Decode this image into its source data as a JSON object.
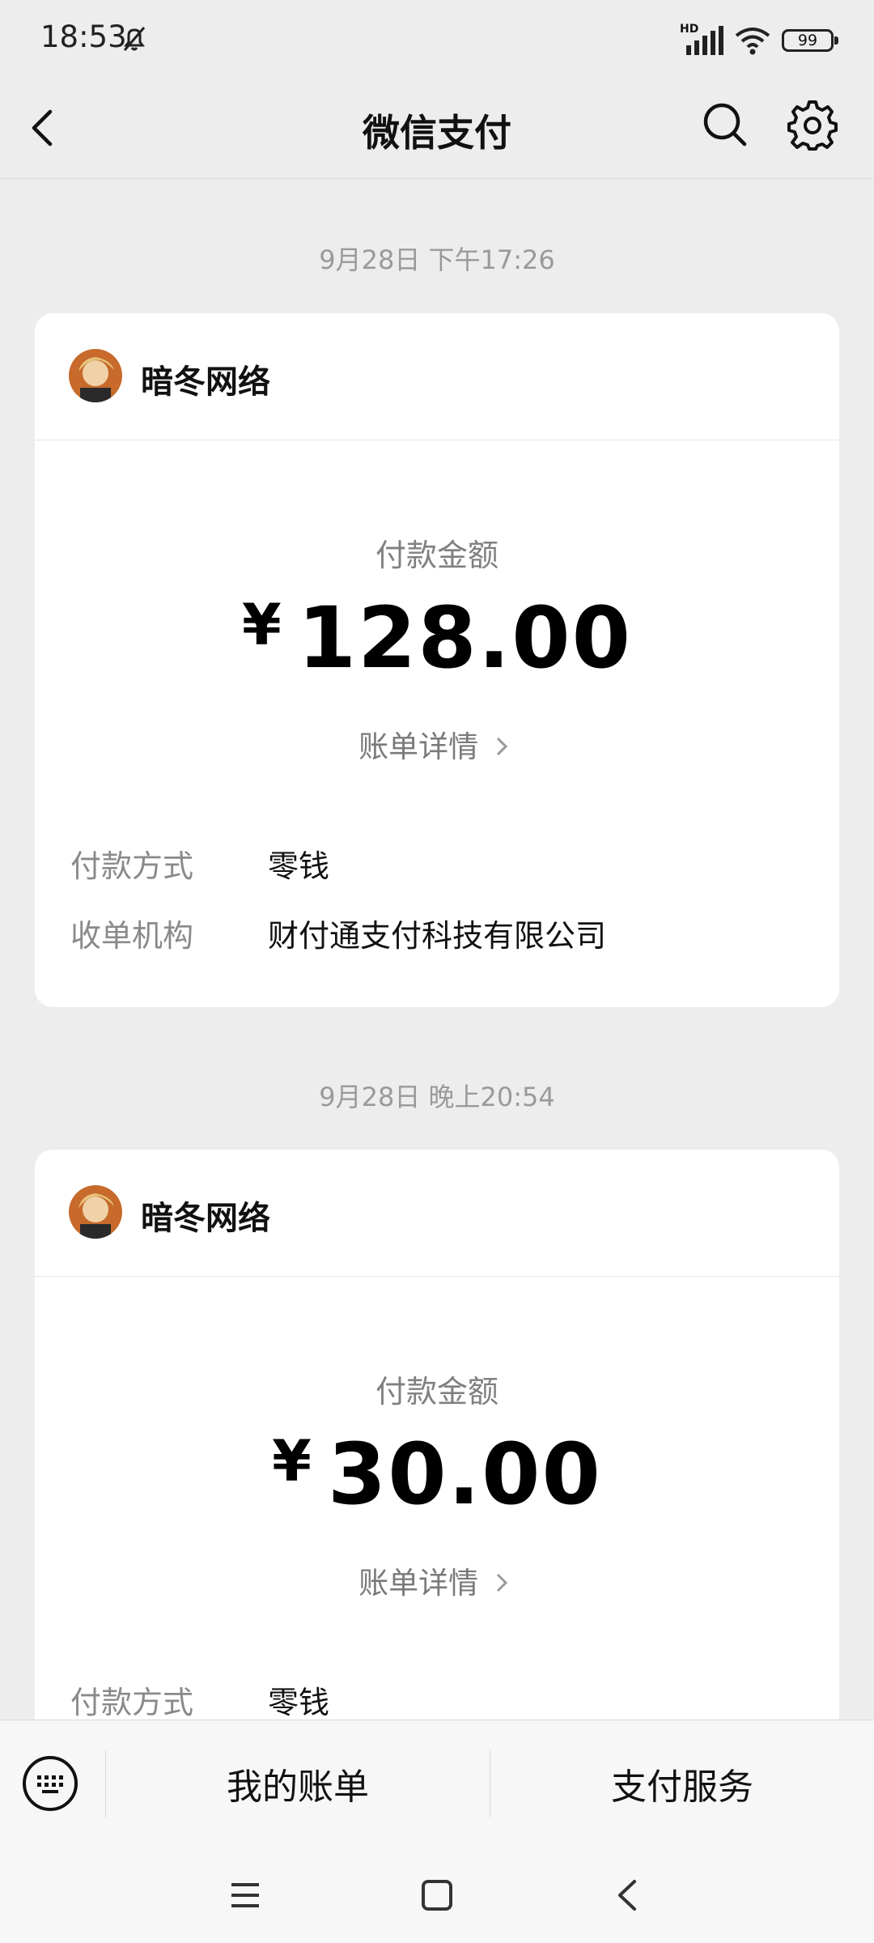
{
  "status_bar": {
    "time": "18:53",
    "network_label": "HD",
    "battery": "99"
  },
  "navbar": {
    "title": "微信支付"
  },
  "transactions": [
    {
      "timestamp": "9月28日 下午17:26",
      "merchant": "暗冬网络",
      "amount_label": "付款金额",
      "currency": "¥",
      "amount": "128.00",
      "detail_link": "账单详情",
      "rows": [
        {
          "key": "付款方式",
          "value": "零钱"
        },
        {
          "key": "收单机构",
          "value": "财付通支付科技有限公司"
        }
      ]
    },
    {
      "timestamp": "9月28日 晚上20:54",
      "merchant": "暗冬网络",
      "amount_label": "付款金额",
      "currency": "¥",
      "amount": "30.00",
      "detail_link": "账单详情",
      "rows": [
        {
          "key": "付款方式",
          "value": "零钱"
        }
      ]
    }
  ],
  "bottom_menu": {
    "item1": "我的账单",
    "item2": "支付服务"
  },
  "icons": {
    "back": "chevron-left-icon",
    "search": "search-icon",
    "settings": "gear-icon",
    "keyboard": "keyboard-icon",
    "mute": "bell-off-icon"
  }
}
